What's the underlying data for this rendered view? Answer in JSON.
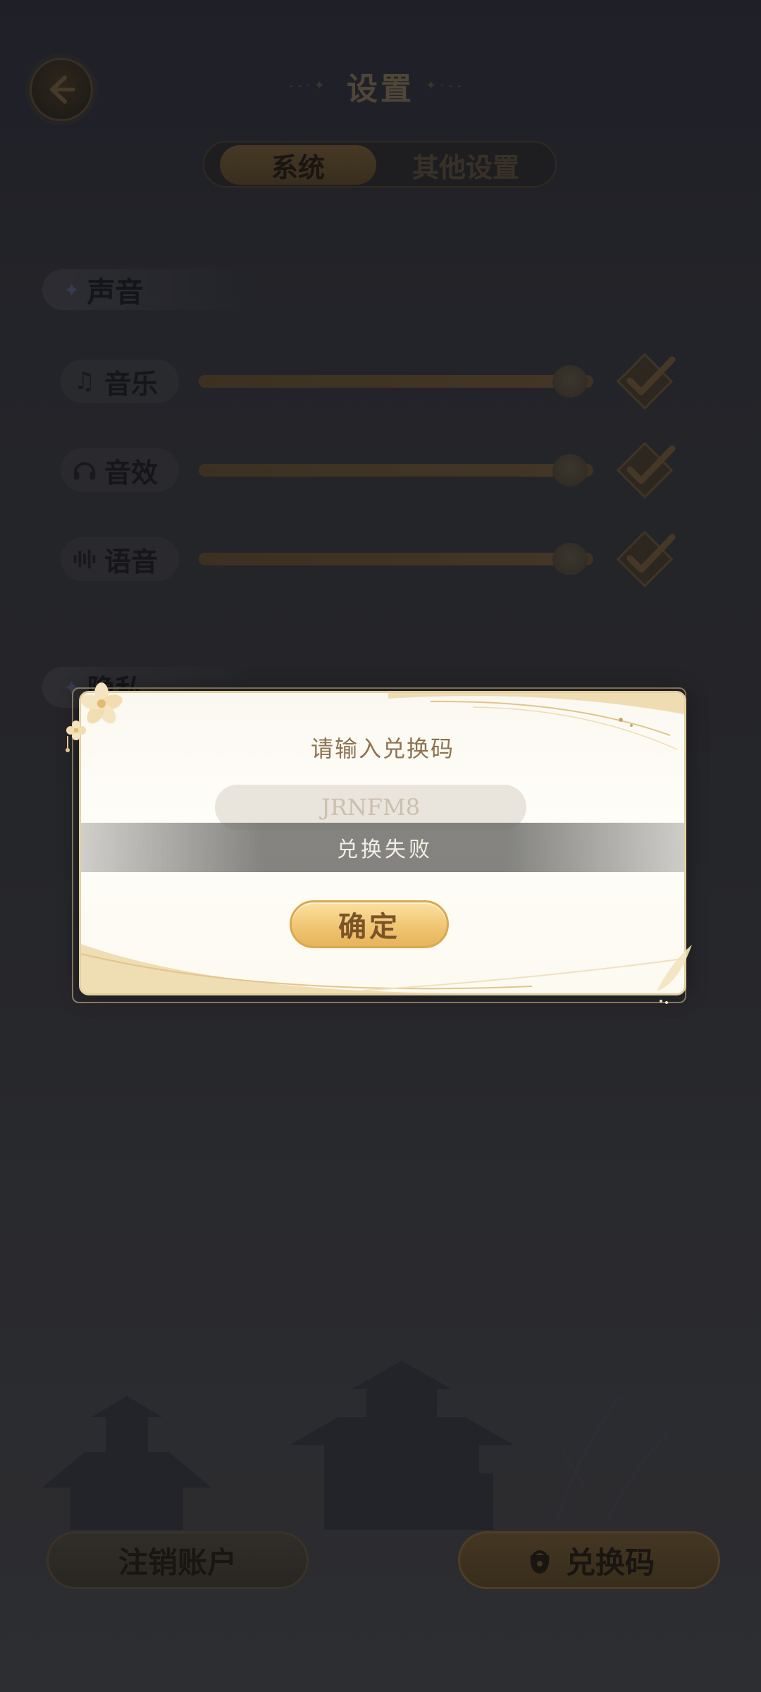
{
  "header": {
    "title": "设置",
    "back_icon": "back-arrow-icon"
  },
  "tabs": [
    {
      "label": "系统",
      "active": true
    },
    {
      "label": "其他设置",
      "active": false
    }
  ],
  "sound_section": {
    "title": "声音",
    "rows": [
      {
        "label": "音乐",
        "icon": "music-note-icon",
        "level": 0.92,
        "enabled": true
      },
      {
        "label": "音效",
        "icon": "headphones-icon",
        "level": 0.92,
        "enabled": true
      },
      {
        "label": "语音",
        "icon": "voice-wave-icon",
        "level": 0.92,
        "enabled": true
      }
    ]
  },
  "privacy_section": {
    "title": "隐私"
  },
  "bottom_buttons": {
    "delete_account": "注销账户",
    "redeem_code": "兑换码",
    "redeem_icon": "gift-bag-icon"
  },
  "dialog": {
    "title": "请输入兑换码",
    "input_value": "JRNFM8",
    "toast": "兑换失败",
    "confirm_label": "确定"
  },
  "colors": {
    "accent_gold": "#f0c673",
    "dialog_bg": "#fffdf8",
    "title_text": "#8d7350"
  }
}
